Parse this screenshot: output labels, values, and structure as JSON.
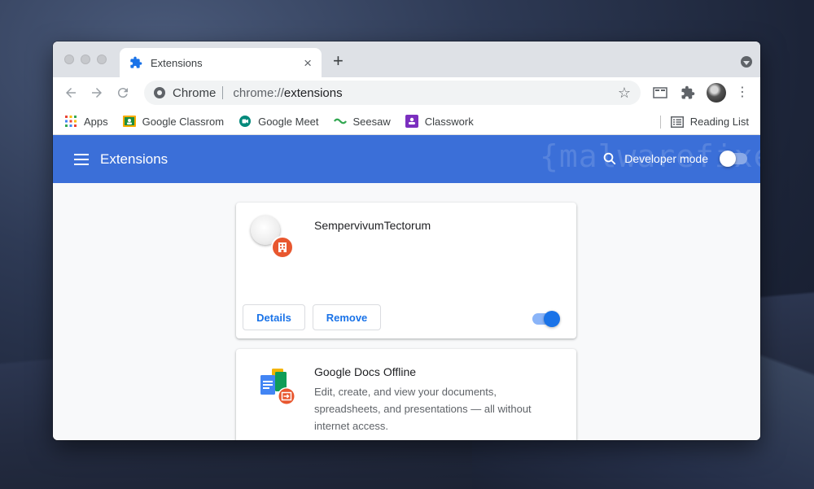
{
  "browser": {
    "tab": {
      "title": "Extensions",
      "close_label": "×"
    },
    "new_tab_label": "+",
    "omnibox": {
      "chip": "Chrome",
      "scheme": "chrome://",
      "path": "extensions"
    }
  },
  "bookmarks": [
    {
      "label": "Apps",
      "icon": "apps-grid-icon"
    },
    {
      "label": "Google Classrom",
      "icon": "google-classroom-icon"
    },
    {
      "label": "Google Meet",
      "icon": "google-meet-icon"
    },
    {
      "label": "Seesaw",
      "icon": "seesaw-icon"
    },
    {
      "label": "Classwork",
      "icon": "classwork-icon"
    }
  ],
  "reading_list": {
    "label": "Reading List"
  },
  "header": {
    "title": "Extensions",
    "developer_mode_label": "Developer mode",
    "developer_mode_on": false,
    "watermark": "{malwarefixes}",
    "accent_color": "#3b6fd8"
  },
  "extensions": [
    {
      "name": "SempervivumTectorum",
      "details_label": "Details",
      "remove_label": "Remove",
      "enabled": true
    },
    {
      "name": "Google Docs Offline",
      "description": "Edit, create, and view your documents, spreadsheets, and presentations — all without internet access."
    }
  ]
}
